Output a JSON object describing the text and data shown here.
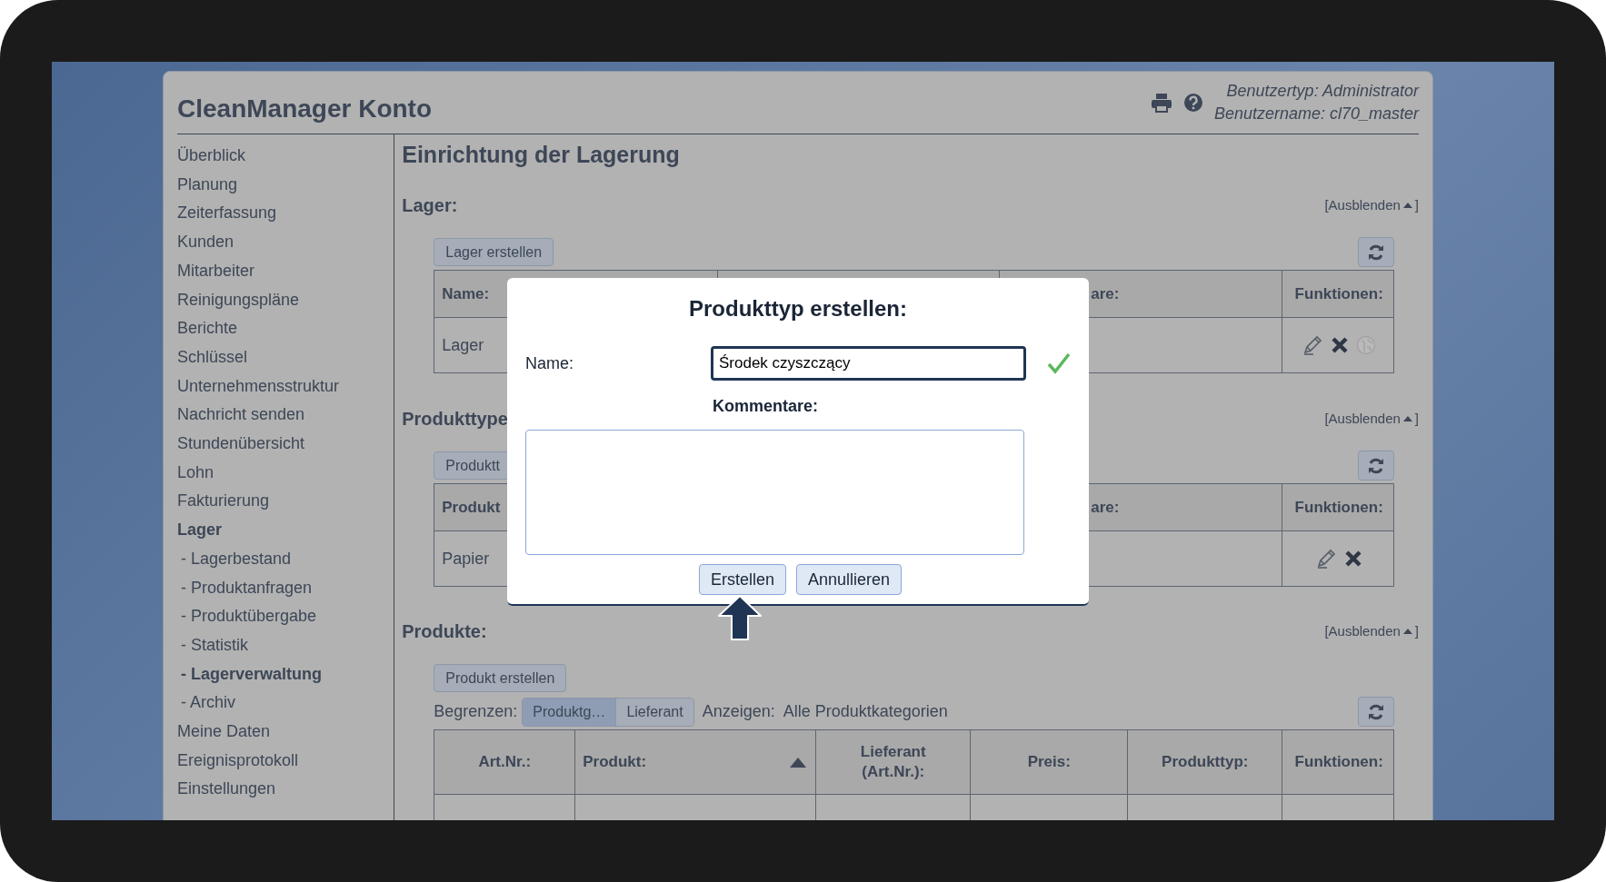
{
  "header": {
    "title": "CleanManager Konto",
    "user_type": "Benutzertyp: Administrator",
    "user_name": "Benutzername: cl70_master"
  },
  "sidebar": {
    "items": [
      {
        "label": "Überblick",
        "selected": false
      },
      {
        "label": "Planung",
        "selected": false
      },
      {
        "label": "Zeiterfassung",
        "selected": false
      },
      {
        "label": "Kunden",
        "selected": false
      },
      {
        "label": "Mitarbeiter",
        "selected": false
      },
      {
        "label": "Reinigungspläne",
        "selected": false
      },
      {
        "label": "Berichte",
        "selected": false
      },
      {
        "label": "Schlüssel",
        "selected": false
      },
      {
        "label": "Unternehmensstruktur",
        "selected": false
      },
      {
        "label": "Nachricht senden",
        "selected": false
      },
      {
        "label": "Stundenübersicht",
        "selected": false
      },
      {
        "label": "Lohn",
        "selected": false
      },
      {
        "label": "Fakturierung",
        "selected": false
      },
      {
        "label": "Lager",
        "selected": true,
        "children": [
          {
            "label": "- Lagerbestand",
            "selected": false
          },
          {
            "label": "- Produktanfragen",
            "selected": false
          },
          {
            "label": "- Produktübergabe",
            "selected": false
          },
          {
            "label": "- Statistik",
            "selected": false
          },
          {
            "label": "- Lagerverwaltung",
            "selected": true
          },
          {
            "label": "- Archiv",
            "selected": false
          }
        ]
      },
      {
        "label": "Meine Daten",
        "selected": false
      },
      {
        "label": "Ereignisprotokoll",
        "selected": false
      },
      {
        "label": "Einstellungen",
        "selected": false
      }
    ]
  },
  "page_title": "Einrichtung der Lagerung",
  "sections": [
    {
      "title": "Lager:",
      "hide_label": "[Ausblenden",
      "hide_close": "]",
      "create_button": "Lager erstellen",
      "table": {
        "columns": [
          {
            "label": "Name:"
          },
          {
            "kind": "hidden"
          },
          {
            "label": "are:",
            "kind": "partial"
          },
          {
            "label": "Funktionen:"
          }
        ],
        "rows": [
          {
            "cells": [
              "Lager"
            ],
            "actions": [
              {
                "kind": "edit",
                "disabled": false
              },
              {
                "kind": "delete",
                "disabled": false
              },
              {
                "kind": "globe",
                "disabled": true
              }
            ]
          }
        ]
      }
    },
    {
      "title": "Produkttype",
      "hide_label": "[Ausblenden",
      "hide_close": "]",
      "create_button": "Produktt",
      "table": {
        "columns": [
          {
            "label": "Produkt"
          },
          {
            "kind": "hidden"
          },
          {
            "label": "are:",
            "kind": "partial"
          },
          {
            "label": "Funktionen:"
          }
        ],
        "rows": [
          {
            "cells": [
              "Papier"
            ],
            "actions": [
              {
                "kind": "edit",
                "disabled": false
              },
              {
                "kind": "delete",
                "disabled": false
              }
            ]
          }
        ]
      }
    },
    {
      "title": "Produkte:",
      "hide_label": "[Ausblenden",
      "hide_close": "]",
      "create_button": "Produkt erstellen",
      "filter": {
        "label": "Begrenzen:",
        "segments": [
          {
            "label": "Produktg…",
            "selected": true
          },
          {
            "label": "Lieferant",
            "selected": false
          }
        ],
        "show_label": "Anzeigen:",
        "show_value": "Alle Produktkategorien"
      },
      "table": {
        "columns": [
          {
            "label": "Art.Nr.:"
          },
          {
            "label": "Produkt:",
            "sort_ascending": true
          },
          {
            "label": "Lieferant (Art.Nr.):"
          },
          {
            "label": "Preis:"
          },
          {
            "label": "Produkttyp:"
          },
          {
            "label": "Funktionen:"
          }
        ],
        "rows": [
          {
            "cells": []
          }
        ]
      }
    }
  ],
  "dialog": {
    "title": "Produkttyp erstellen:",
    "name_label": "Name:",
    "name_value": "Środek czyszczący",
    "name_valid": true,
    "comment_label": "Kommentare:",
    "buttons": [
      {
        "label": "Erstellen",
        "pointed": true
      },
      {
        "label": "Annullieren",
        "pointed": false
      }
    ]
  }
}
